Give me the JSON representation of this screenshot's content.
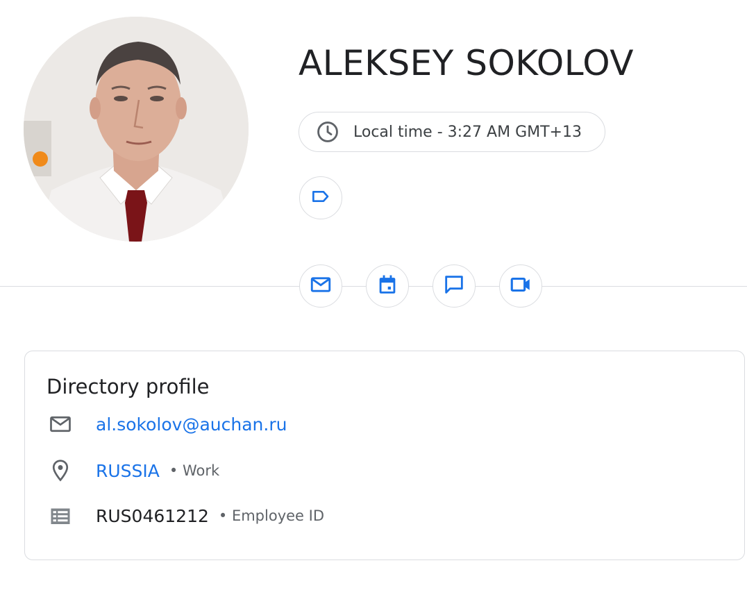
{
  "profile": {
    "name": "ALEKSEY SOKOLOV",
    "local_time": "Local time - 3:27 AM GMT+13"
  },
  "icons": {
    "clock": "clock-icon",
    "label": "label-icon",
    "mail": "mail-icon",
    "calendar": "calendar-icon",
    "chat": "chat-icon",
    "video": "video-camera-icon",
    "location": "location-pin-icon",
    "employee_id": "badge-list-icon"
  },
  "directory": {
    "title": "Directory profile",
    "email": "al.sokolov@auchan.ru",
    "location": "RUSSIA",
    "location_type": "• Work",
    "employee_id": "RUS0461212",
    "employee_id_label": "• Employee ID"
  },
  "colors": {
    "accent": "#1a73e8",
    "border": "#dadce0",
    "text": "#202124",
    "muted": "#5f6368"
  }
}
